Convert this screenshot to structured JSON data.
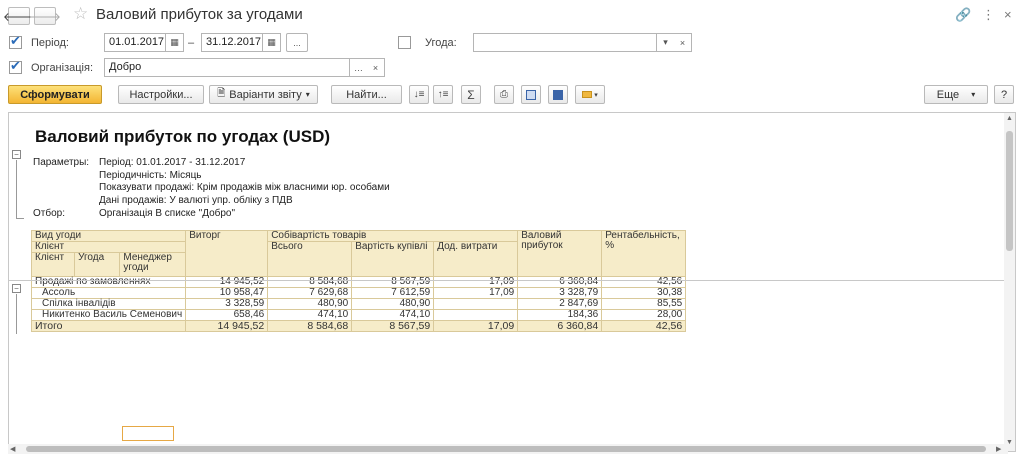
{
  "window": {
    "title": "Валовий прибуток за угодами"
  },
  "filters": {
    "period": {
      "label": "Період:",
      "from": "01.01.2017",
      "dash": "–",
      "to": "31.12.2017",
      "dots": "..."
    },
    "deal": {
      "label": "Угода:",
      "value": ""
    },
    "organization": {
      "label": "Організація:",
      "value": "Добро"
    }
  },
  "toolbar": {
    "generate": "Сформувати",
    "settings": "Настройки...",
    "variants": "Варіанти звіту",
    "find": "Найти...",
    "more": "Еще",
    "help": "?"
  },
  "report": {
    "title": "Валовий прибуток по угодах (USD)",
    "params_label": "Параметры:",
    "params": [
      "Період: 01.01.2017 - 31.12.2017",
      "Періодичність: Місяць",
      "Показувати продажі: Крім продажів між власними юр. особами",
      "Дані продажів: У валюті упр. обліку з ПДВ"
    ],
    "filter_label": "Отбор:",
    "filter_value": "Організація В списке \"Добро\""
  },
  "table": {
    "headers": {
      "deal_type": "Вид угоди",
      "client_group": "Клієнт",
      "client": "Клієнт",
      "deal": "Угода",
      "manager": "Менеджер угоди",
      "revenue": "Виторг",
      "cost": "Собівартість товарів",
      "cost_total": "Всього",
      "purchase": "Вартість купівлі",
      "extra": "Дод. витрати",
      "gross": "Валовий прибуток",
      "profitability": "Рентабельність, %"
    },
    "group_row": {
      "name": "Продажі по замовленнях",
      "revenue": "14 945,52",
      "cost_total": "8 584,68",
      "purchase": "8 567,59",
      "extra": "17,09",
      "gross": "6 360,84",
      "profitability": "42,56"
    },
    "rows": [
      {
        "name": "Ассоль",
        "revenue": "10 958,47",
        "cost_total": "7 629,68",
        "purchase": "7 612,59",
        "extra": "17,09",
        "gross": "3 328,79",
        "profitability": "30,38"
      },
      {
        "name": "Спілка інвалідів",
        "revenue": "3 328,59",
        "cost_total": "480,90",
        "purchase": "480,90",
        "extra": "",
        "gross": "2 847,69",
        "profitability": "85,55"
      },
      {
        "name": "Никитенко Василь Семенович",
        "revenue": "658,46",
        "cost_total": "474,10",
        "purchase": "474,10",
        "extra": "",
        "gross": "184,36",
        "profitability": "28,00"
      }
    ],
    "total": {
      "name": "Итого",
      "revenue": "14 945,52",
      "cost_total": "8 584,68",
      "purchase": "8 567,59",
      "extra": "17,09",
      "gross": "6 360,84",
      "profitability": "42,56"
    }
  }
}
